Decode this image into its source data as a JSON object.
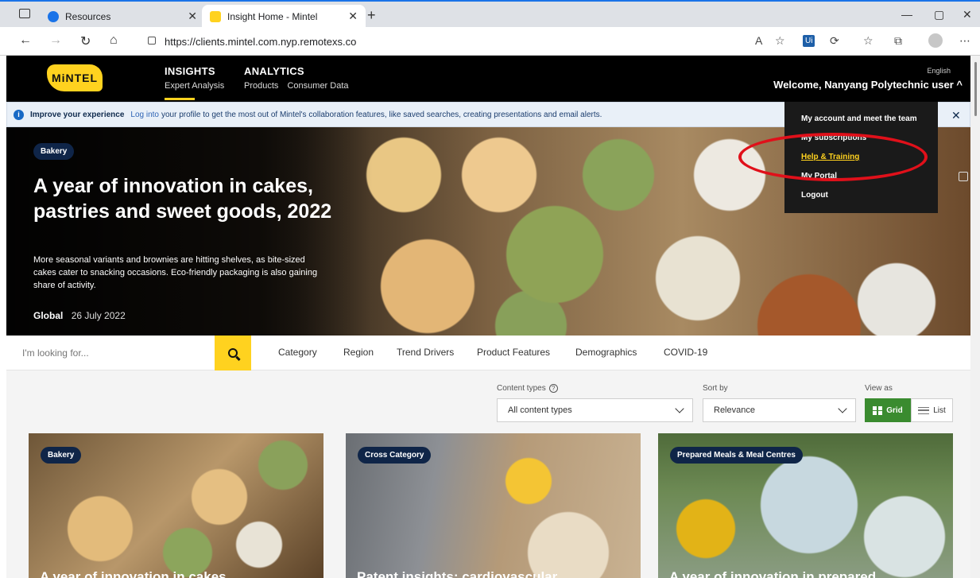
{
  "browser": {
    "tabs": [
      {
        "title": "Resources"
      },
      {
        "title": "Insight Home - Mintel"
      }
    ],
    "url": "https://clients.mintel.com.nyp.remotexs.co"
  },
  "header": {
    "logo": "MiNTEL",
    "insights": {
      "title": "INSIGHTS",
      "sub": [
        "Expert Analysis"
      ]
    },
    "analytics": {
      "title": "ANALYTICS",
      "sub": [
        "Products",
        "Consumer Data"
      ]
    },
    "language": "English",
    "welcome": "Welcome, Nanyang Polytechnic user ^"
  },
  "banner": {
    "bold": "Improve your experience",
    "link": "Log into",
    "text": "your profile to get the most out of Mintel's collaboration features, like saved searches, creating presentations and email alerts."
  },
  "dropdown": {
    "items": [
      "My account and meet the team",
      "My subscriptions",
      "Help & Training",
      "My Portal",
      "Logout"
    ]
  },
  "hero": {
    "tag": "Bakery",
    "title": "A year of innovation in cakes, pastries and sweet goods, 2022",
    "description": "More seasonal variants and brownies are hitting shelves, as bite-sized cakes cater to snacking occasions. Eco-friendly packaging is also gaining share of activity.",
    "region": "Global",
    "date": "26 July 2022"
  },
  "search": {
    "placeholder": "I'm looking for...",
    "filters": [
      "Category",
      "Region",
      "Trend Drivers",
      "Product Features",
      "Demographics",
      "COVID-19"
    ]
  },
  "controls": {
    "content_types_label": "Content types",
    "content_types_value": "All content types",
    "sort_label": "Sort by",
    "sort_value": "Relevance",
    "view_label": "View as",
    "view_grid": "Grid",
    "view_list": "List"
  },
  "cards": [
    {
      "tag": "Bakery",
      "title": "A year of innovation in cakes,"
    },
    {
      "tag": "Cross Category",
      "title": "Patent insights: cardiovascular"
    },
    {
      "tag": "Prepared Meals & Meal Centres",
      "title": "A year of innovation in prepared"
    }
  ],
  "colors": {
    "brand_yellow": "#ffd21f",
    "navy_pill": "#0f2548",
    "grid_green": "#3a8b2f",
    "annotation_red": "#e0101a"
  }
}
